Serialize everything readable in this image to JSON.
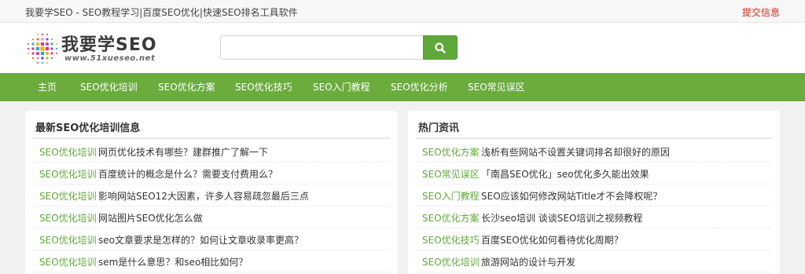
{
  "topbar": {
    "site_description": "我要学SEO - SEO教程学习|百度SEO优化|快速SEO排名工具软件",
    "submit_link": "提交信息",
    "accent_color": "#d9261c"
  },
  "logo": {
    "title": "我要学SEO",
    "url_text": "www.51xueseo.net"
  },
  "search": {
    "placeholder": "",
    "button_icon": "search-icon",
    "button_color": "#5fa83a"
  },
  "nav": {
    "color": "#6bac3d",
    "items": [
      {
        "label": "主页"
      },
      {
        "label": "SEO优化培训"
      },
      {
        "label": "SEO优化方案"
      },
      {
        "label": "SEO优化技巧"
      },
      {
        "label": "SEO入门教程"
      },
      {
        "label": "SEO优化分析"
      },
      {
        "label": "SEO常见误区"
      }
    ]
  },
  "left_panel": {
    "title": "最新SEO优化培训信息",
    "items": [
      {
        "category": "SEO优化培训",
        "title": "网页优化技术有哪些？建群推广了解一下"
      },
      {
        "category": "SEO优化培训",
        "title": "百度统计的概念是什么？需要支付费用么？"
      },
      {
        "category": "SEO优化培训",
        "title": "影响网站SEO12大因素，许多人容易疏忽最后三点"
      },
      {
        "category": "SEO优化培训",
        "title": "网站图片SEO优化怎么做"
      },
      {
        "category": "SEO优化培训",
        "title": "seo文章要求是怎样的？如何让文章收录率更高？"
      },
      {
        "category": "SEO优化培训",
        "title": "sem是什么意思？和seo相比如何？"
      }
    ]
  },
  "right_panel": {
    "title": "热门资讯",
    "items": [
      {
        "category": "SEO优化方案",
        "title": "浅析有些网站不设置关键词排名却很好的原因"
      },
      {
        "category": "SEO常见误区",
        "title": "「南昌SEO优化」seo优化多久能出效果"
      },
      {
        "category": "SEO入门教程",
        "title": "SEO应该如何修改网站Title才不会降权呢？"
      },
      {
        "category": "SEO优化方案",
        "title": "长沙seo培训 谈谈SEO培训之视频教程"
      },
      {
        "category": "SEO优化技巧",
        "title": "百度SEO优化如何看待优化周期？"
      },
      {
        "category": "SEO优化培训",
        "title": "旅游网站的设计与开发"
      }
    ]
  }
}
